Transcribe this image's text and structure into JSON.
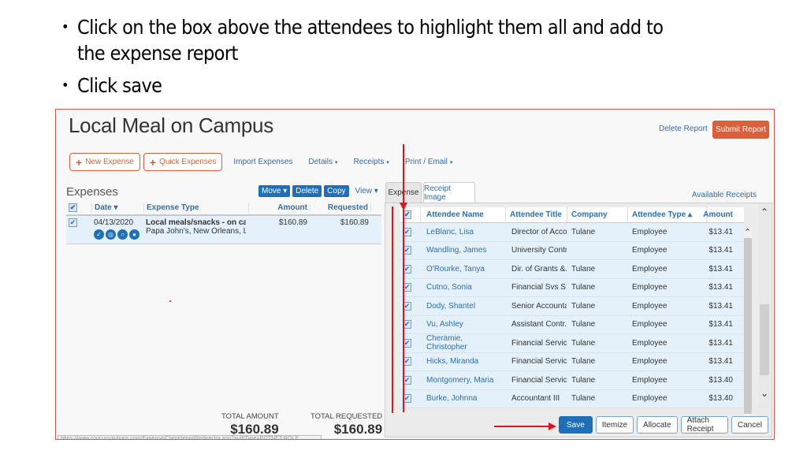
{
  "instructions": [
    {
      "bullet": "•",
      "text": "Click on the box above the attendees to highlight them all and add to the expense report"
    },
    {
      "bullet": "•",
      "text": "Click save"
    }
  ],
  "report": {
    "title": "Local Meal on Campus",
    "delete_report": "Delete Report",
    "submit_report": "Submit Report"
  },
  "toolbar": {
    "new_expense": "New Expense",
    "quick_expenses": "Quick Expenses",
    "import_expenses": "Import Expenses",
    "details": "Details",
    "receipts": "Receipts",
    "print_email": "Print / Email",
    "plus": "+",
    "caret": "▾"
  },
  "expenses": {
    "heading": "Expenses",
    "buttons": {
      "move": "Move ▾",
      "delete": "Delete",
      "copy": "Copy",
      "view": "View ▾",
      "collapse": "«"
    },
    "columns": {
      "date": "Date ▾",
      "type": "Expense Type",
      "amount": "Amount",
      "requested": "Requested"
    },
    "rows": [
      {
        "checked": true,
        "date": "04/13/2020",
        "type": "Local meals/snacks - on campus",
        "vendor": "Papa John's, New Orleans, Louisiana",
        "amount": "$160.89",
        "requested": "$160.89",
        "icons": [
          "receipt-icon",
          "globe-icon",
          "comment-icon",
          "attendees-icon"
        ]
      }
    ],
    "totals": {
      "amount_label": "TOTAL AMOUNT",
      "amount_value": "$160.89",
      "requested_label": "TOTAL REQUESTED",
      "requested_value": "$160.89"
    },
    "status_url": "https://www.concursolutions.com/Expense/Client/reportRedirector.asp?authType=POTNET-ROLE"
  },
  "detail_panel": {
    "tabs": [
      {
        "label": "Expense",
        "active": true
      },
      {
        "label": "Receipt Image",
        "active": false
      }
    ],
    "available_receipts": "Available Receipts",
    "attendee_columns": {
      "name": "Attendee Name",
      "title": "Attendee Title",
      "company": "Company",
      "type": "Attendee Type ▴",
      "amount": "Amount"
    },
    "select_all_checked": true,
    "attendees": [
      {
        "checked": true,
        "name": "LeBlanc, Lisa",
        "title": "Director of Acco...",
        "company": "Tulane",
        "type": "Employee",
        "amount": "$13.41"
      },
      {
        "checked": true,
        "name": "Wandling, James",
        "title": "University Contr...",
        "company": "",
        "type": "Employee",
        "amount": "$13.41"
      },
      {
        "checked": true,
        "name": "O'Rourke, Tanya",
        "title": "Dir. of Grants &...",
        "company": "Tulane",
        "type": "Employee",
        "amount": "$13.41"
      },
      {
        "checked": true,
        "name": "Cutno, Sonia",
        "title": "Financial Svs S...",
        "company": "Tulane",
        "type": "Employee",
        "amount": "$13.41"
      },
      {
        "checked": true,
        "name": "Dody, Shantel",
        "title": "Senior Accountant",
        "company": "Tulane",
        "type": "Employee",
        "amount": "$13.41"
      },
      {
        "checked": true,
        "name": "Vu, Ashley",
        "title": "Assistant Contr...",
        "company": "Tulane",
        "type": "Employee",
        "amount": "$13.41"
      },
      {
        "checked": true,
        "name": "Cheramie, Christopher",
        "title": "Financial Servic...",
        "company": "Tulane",
        "type": "Employee",
        "amount": "$13.41"
      },
      {
        "checked": true,
        "name": "Hicks, Miranda",
        "title": "Financial Servic...",
        "company": "Tulane",
        "type": "Employee",
        "amount": "$13.41"
      },
      {
        "checked": true,
        "name": "Montgomery, Maria",
        "title": "Financial Servic...",
        "company": "Tulane",
        "type": "Employee",
        "amount": "$13.40"
      },
      {
        "checked": true,
        "name": "Burke, Johnna",
        "title": "Accountant III",
        "company": "Tulane",
        "type": "Employee",
        "amount": "$13.40"
      }
    ],
    "actions": {
      "save": "Save",
      "itemize": "Itemize",
      "allocate": "Allocate",
      "attach_receipt": "Attach Receipt",
      "cancel": "Cancel"
    },
    "scroll": {
      "up": "⌃",
      "down": "⌄"
    }
  },
  "colors": {
    "accent_orange": "#d9603b",
    "primary_blue": "#1e6fb8",
    "link_blue": "#2f6ea8",
    "annotation_red": "#e0151b",
    "row_highlight": "#e4f1fb"
  }
}
